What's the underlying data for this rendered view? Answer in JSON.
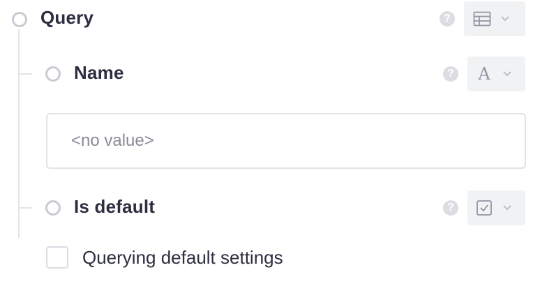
{
  "query": {
    "label": "Query",
    "help_glyph": "?",
    "type_icon": "table-icon"
  },
  "name_field": {
    "label": "Name",
    "help_glyph": "?",
    "type_icon": "text-type-icon",
    "type_glyph": "A",
    "placeholder": "<no value>",
    "value": ""
  },
  "is_default_field": {
    "label": "Is default",
    "help_glyph": "?",
    "type_icon": "checkbox-type-icon",
    "checkbox_label": "Querying default settings",
    "checked": false
  },
  "colors": {
    "text": "#2d2e3f",
    "muted": "#8a8b96",
    "border": "#e1e2e6",
    "button_bg": "#f1f2f4",
    "icon": "#8f95a3"
  }
}
